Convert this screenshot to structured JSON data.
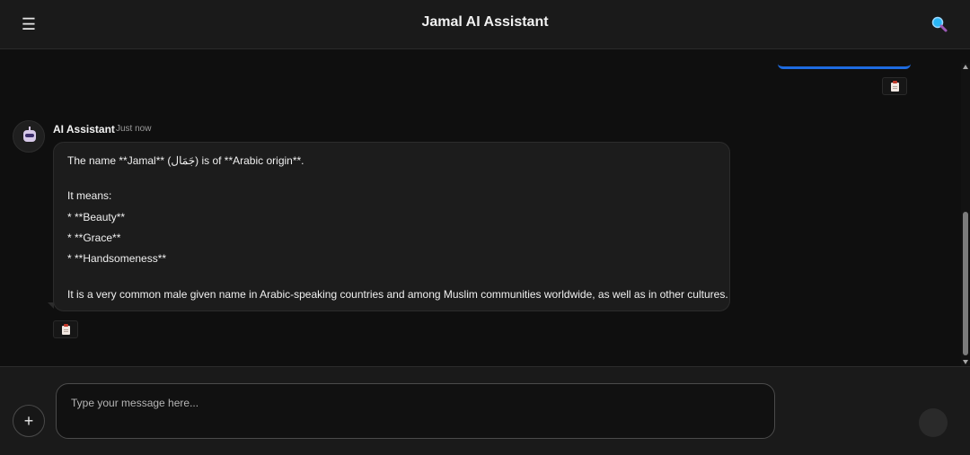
{
  "header": {
    "title": "Jamal AI Assistant",
    "menu_icon": "menu-icon",
    "menu_glyph": "☰",
    "search_icon": "search-icon"
  },
  "chat": {
    "assistant": {
      "name": "AI Assistant",
      "time": "Just now",
      "avatar_icon": "robot-avatar-icon",
      "lines": [
        "The name **Jamal** (جَمَال) is of **Arabic origin**.",
        "It means:",
        "* **Beauty**",
        "* **Grace**",
        "* **Handsomeness**",
        "It is a very common male given name in Arabic-speaking countries and among Muslim communities worldwide, as well as in other cultures."
      ]
    },
    "copy_icon": "clipboard-icon"
  },
  "composer": {
    "add_label": "+",
    "placeholder": "Type your message here...",
    "send_icon": "send-icon"
  },
  "colors": {
    "accent": "#1e6be0",
    "background": "#0f0f0f",
    "bubble": "#1c1c1c"
  }
}
